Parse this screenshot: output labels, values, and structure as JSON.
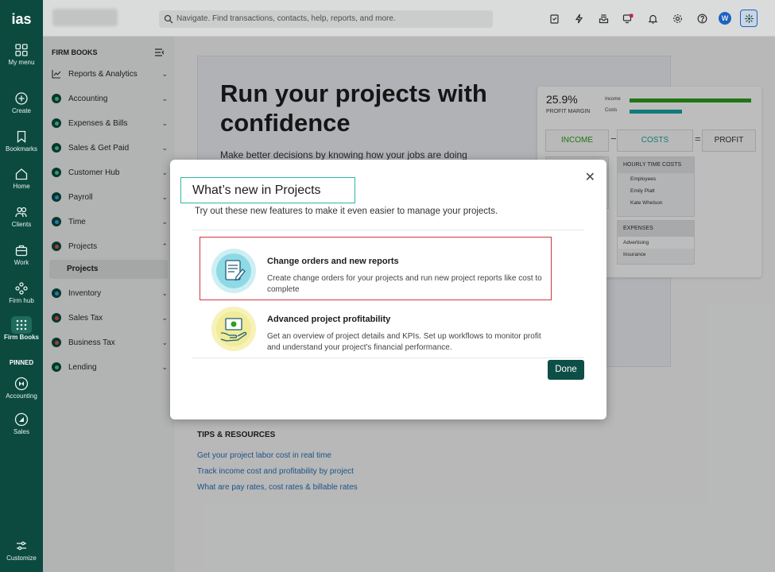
{
  "rail": {
    "logo": "ias",
    "items": [
      {
        "label": "My menu",
        "icon": "grid-icon"
      },
      {
        "label": "Create",
        "icon": "plus-circle-icon"
      },
      {
        "label": "Bookmarks",
        "icon": "bookmark-icon"
      },
      {
        "label": "Home",
        "icon": "home-icon"
      },
      {
        "label": "Clients",
        "icon": "clients-icon"
      },
      {
        "label": "Work",
        "icon": "briefcase-icon"
      },
      {
        "label": "Firm hub",
        "icon": "hub-icon"
      },
      {
        "label": "Firm Books",
        "icon": "dots-grid-icon"
      }
    ],
    "pinned_label": "PINNED",
    "pinned": [
      {
        "label": "Accounting",
        "icon": "accounting-icon"
      },
      {
        "label": "Sales",
        "icon": "sales-icon"
      }
    ],
    "customize": "Customize"
  },
  "topbar": {
    "search_placeholder": "Navigate. Find transactions, contacts, help, reports, and more.",
    "avatar_letter": "W"
  },
  "nav": {
    "title": "FIRM BOOKS",
    "items": [
      {
        "label": "Reports & Analytics"
      },
      {
        "label": "Accounting"
      },
      {
        "label": "Expenses & Bills"
      },
      {
        "label": "Sales & Get Paid"
      },
      {
        "label": "Customer Hub"
      },
      {
        "label": "Payroll"
      },
      {
        "label": "Time"
      },
      {
        "label": "Projects"
      },
      {
        "label": "Inventory"
      },
      {
        "label": "Sales Tax"
      },
      {
        "label": "Business Tax"
      },
      {
        "label": "Lending"
      }
    ],
    "active_sub": "Projects"
  },
  "hero": {
    "title": "Run your projects with confidence",
    "subtitle": "Make better decisions by knowing how your jobs are doing",
    "card": {
      "profit_value": "25.9%",
      "profit_label": "PROFIT MARGIN",
      "income_label": "Income",
      "costs_label": "Costs",
      "income_box": "INCOME",
      "costs_box": "COSTS",
      "profit_box": "PROFIT",
      "minus": "−",
      "equals": "=",
      "hourly_title": "HOURLY TIME COSTS",
      "hourly_rows": [
        "Employees",
        "Emily Platt",
        "Kate Whelson"
      ],
      "expenses_title": "EXPENSES",
      "expenses_rows": [
        "Advertising",
        "Insurance"
      ],
      "colors": {
        "income": "#2ca01c",
        "costs": "#1aa5a5"
      }
    }
  },
  "tips": {
    "title": "TIPS & RESOURCES",
    "links": [
      "Get your project labor cost in real time",
      "Track income cost and profitability by project",
      "What are pay rates, cost rates & billable rates"
    ]
  },
  "modal": {
    "title": "What’s new in Projects",
    "subtitle": "Try out these new features to make it even easier to manage your projects.",
    "features": [
      {
        "title": "Change orders and new reports",
        "desc": "Create change orders for your projects and run new project reports like cost to complete",
        "icon": "document-edit-icon"
      },
      {
        "title": "Advanced project profitability",
        "desc": "Get an overview of project details and KPIs. Set up workflows to monitor profit and understand your project's financial performance.",
        "icon": "money-hand-icon"
      }
    ],
    "done_label": "Done",
    "close": "✕"
  }
}
